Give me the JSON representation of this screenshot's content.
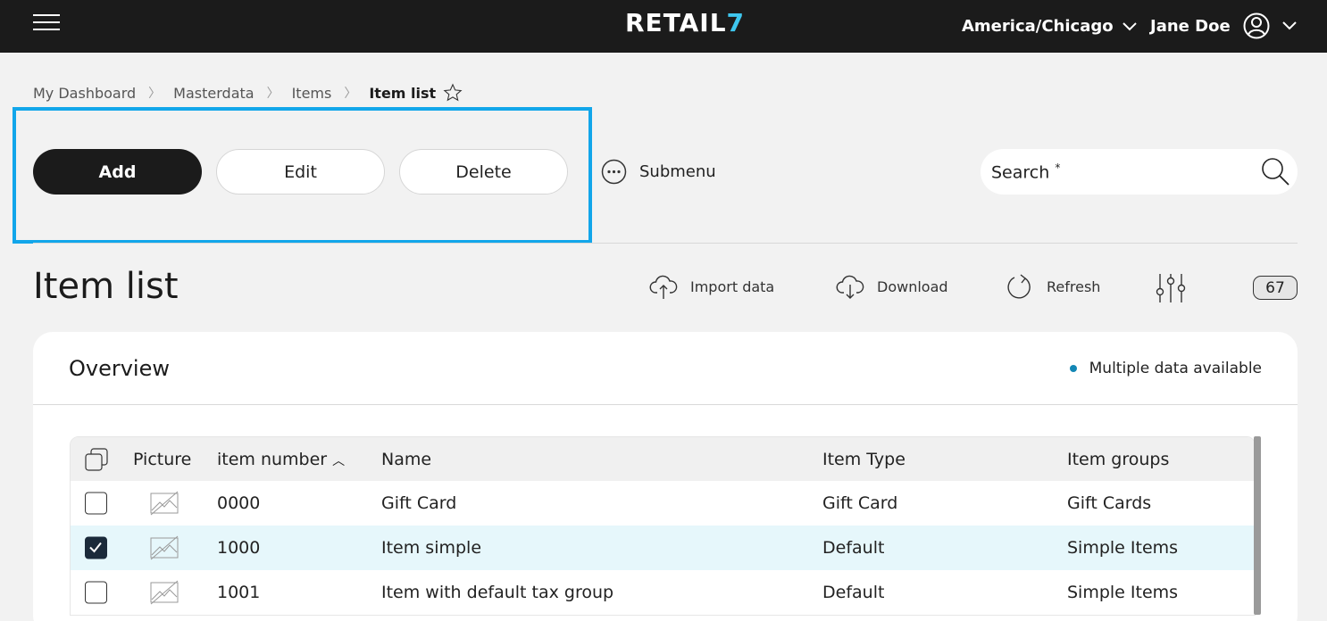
{
  "topbar": {
    "logo": "RETAIL",
    "logo_accent": "7",
    "timezone": "America/Chicago",
    "user_name": "Jane Doe"
  },
  "breadcrumb": {
    "items": [
      "My Dashboard",
      "Masterdata",
      "Items"
    ],
    "current": "Item list"
  },
  "toolbar": {
    "add_label": "Add",
    "edit_label": "Edit",
    "delete_label": "Delete",
    "submenu_label": "Submenu",
    "search_label": "Search",
    "search_required": "*"
  },
  "page": {
    "title": "Item list",
    "import_label": "Import data",
    "download_label": "Download",
    "refresh_label": "Refresh",
    "count": "67"
  },
  "overview": {
    "title": "Overview",
    "status": "Multiple data available",
    "status_color": "#1387b5"
  },
  "table": {
    "columns": {
      "picture": "Picture",
      "item_number": "item number",
      "name": "Name",
      "item_type": "Item Type",
      "item_groups": "Item groups"
    },
    "rows": [
      {
        "number": "0000",
        "name": "Gift Card",
        "type": "Gift Card",
        "group": "Gift Cards",
        "checked": false
      },
      {
        "number": "1000",
        "name": "Item simple",
        "type": "Default",
        "group": "Simple Items",
        "checked": true
      },
      {
        "number": "1001",
        "name": "Item with default tax group",
        "type": "Default",
        "group": "Simple Items",
        "checked": false
      }
    ]
  },
  "colors": {
    "accent": "#12a6ea",
    "dark": "#1b1b1b",
    "selected_row": "#e6f7fb"
  }
}
